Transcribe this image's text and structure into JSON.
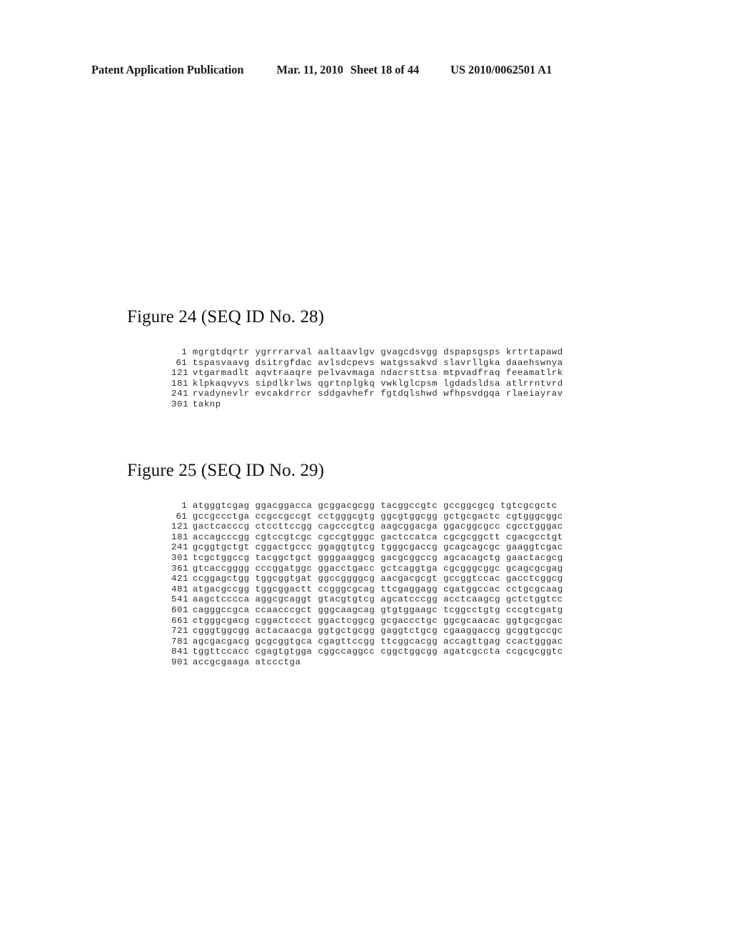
{
  "header": {
    "publication": "Patent Application Publication",
    "date": "Mar. 11, 2010",
    "sheet": "Sheet 18 of 44",
    "document_number": "US 2010/0062501 A1"
  },
  "figures": [
    {
      "caption": "Figure 24 (SEQ ID No. 28)",
      "sequence_type": "protein",
      "rows": [
        {
          "index": "1",
          "chunks": "mgrgtdqrtr ygrrrarval aaltaavlgv gvagcdsvgg dspapsgsps krtrtapawd"
        },
        {
          "index": "61",
          "chunks": "tspasvaavg dsitrgfdac avlsdcpevs watgssakvd slavrllgka daaehswnya"
        },
        {
          "index": "121",
          "chunks": "vtgarmadlt aqvtraaqre pelvavmaga ndacrsttsa mtpvadfraq feeamatlrk"
        },
        {
          "index": "181",
          "chunks": "klpkaqvyvs sipdlkrlws qgrtnplgkq vwklglcpsm lgdadsldsa atlrrntvrd"
        },
        {
          "index": "241",
          "chunks": "rvadynevlr evcakdrrcr sddgavhefr fgtdqlshwd wfhpsvdgqa rlaeiayrav"
        },
        {
          "index": "301",
          "chunks": "taknp"
        }
      ]
    },
    {
      "caption": "Figure 25 (SEQ ID No. 29)",
      "sequence_type": "dna",
      "rows": [
        {
          "index": "1",
          "chunks": "atgggtcgag ggacggacca gcggacgcgg tacggccgtc gccggcgcg tgtcgcgctc"
        },
        {
          "index": "61",
          "chunks": "gccgccctga ccgccgccgt cctgggcgtg ggcgtggcgg gctgcgactc cgtgggcggc"
        },
        {
          "index": "121",
          "chunks": "gactcacccg ctccttccgg cagcccgtcg aagcggacga ggacggcgcc cgcctgggac"
        },
        {
          "index": "181",
          "chunks": "accagcccgg cgtccgtcgc cgccgtgggc gactccatca cgcgcggctt cgacgcctgt"
        },
        {
          "index": "241",
          "chunks": "gcggtgctgt cggactgccc ggaggtgtcg tgggcgaccg gcagcagcgc gaaggtcgac"
        },
        {
          "index": "301",
          "chunks": "tcgctggccg tacggctgct ggggaaggcg gacgcggccg agcacagctg gaactacgcg"
        },
        {
          "index": "361",
          "chunks": "gtcaccgggg cccggatggc ggacctgacc gctcaggtga cgcgggcggc gcagcgcgag"
        },
        {
          "index": "421",
          "chunks": "ccggagctgg tggcggtgat ggccggggcg aacgacgcgt gccggtccac gacctcggcg"
        },
        {
          "index": "481",
          "chunks": "atgacgccgg tggcggactt ccgggcgcag ttcgaggagg cgatggccac cctgcgcaag"
        },
        {
          "index": "541",
          "chunks": "aagctcccca aggcgcaggt gtacgtgtcg agcatcccgg acctcaagcg gctctggtcc"
        },
        {
          "index": "601",
          "chunks": "cagggccgca ccaacccgct gggcaagcag gtgtggaagc tcggcctgtg cccgtcgatg"
        },
        {
          "index": "661",
          "chunks": "ctgggcgacg cggactccct ggactcggcg gcgaccctgc ggcgcaacac ggtgcgcgac"
        },
        {
          "index": "721",
          "chunks": "cgggtggcgg actacaacga ggtgctgcgg gaggtctgcg cgaaggaccg gcggtgccgc"
        },
        {
          "index": "781",
          "chunks": "agcgacgacg gcgcggtgca cgagttccgg ttcggcacgg accagttgag ccactgggac"
        },
        {
          "index": "841",
          "chunks": "tggttccacc cgagtgtgga cggccaggcc cggctggcgg agatcgccta ccgcgcggtc"
        },
        {
          "index": "901",
          "chunks": "accgcgaaga atccctga"
        }
      ]
    }
  ]
}
